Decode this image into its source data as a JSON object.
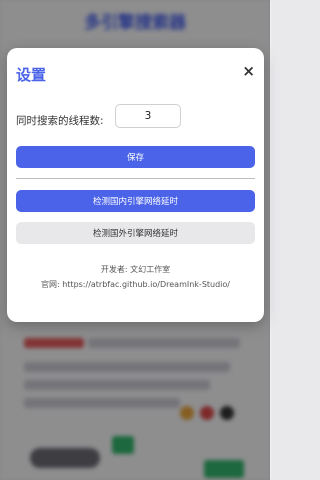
{
  "background": {
    "app_title": "多引擎搜索器"
  },
  "modal": {
    "title": "设置",
    "close_symbol": "×",
    "thread_label": "同时搜索的线程数:",
    "thread_value": "3",
    "save_label": "保存",
    "check_domestic_label": "检测国内引擎网络延时",
    "check_foreign_label": "检测国外引擎网络延时",
    "developer_text": "开发者: 文幻工作室",
    "website_text": "官网: https://atrbfac.github.io/DreamInk-Studio/"
  },
  "colors": {
    "accent": "#4a63e8",
    "secondary_button": "#e8e8ea",
    "overlay": "rgba(0,0,0,0.42)"
  },
  "icons": {
    "close": "close-icon"
  }
}
